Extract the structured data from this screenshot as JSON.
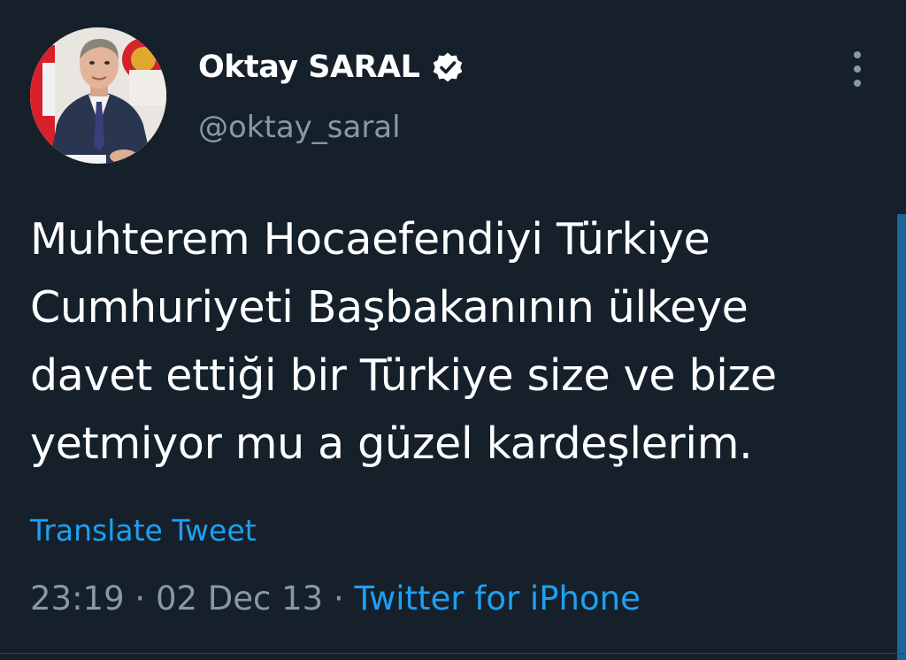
{
  "user": {
    "display_name": "Oktay SARAL",
    "handle": "@oktay_saral",
    "verified": true
  },
  "tweet": {
    "lines": [
      "Muhterem Hocaefendiyi Türkiye",
      "Cumhuriyeti Başbakanının ülkeye",
      "davet ettiği bir Türkiye size ve bize",
      "yetmiyor mu a güzel kardeşlerim."
    ],
    "translate_label": "Translate Tweet",
    "time": "23:19",
    "date": "02 Dec 13",
    "separator": "·",
    "source": "Twitter for iPhone"
  },
  "icons": {
    "verified": "verified-badge-icon",
    "more": "more-vertical-icon"
  },
  "colors": {
    "background": "#15202b",
    "text": "#ffffff",
    "muted": "#8899a6",
    "accent": "#1da1f2"
  }
}
